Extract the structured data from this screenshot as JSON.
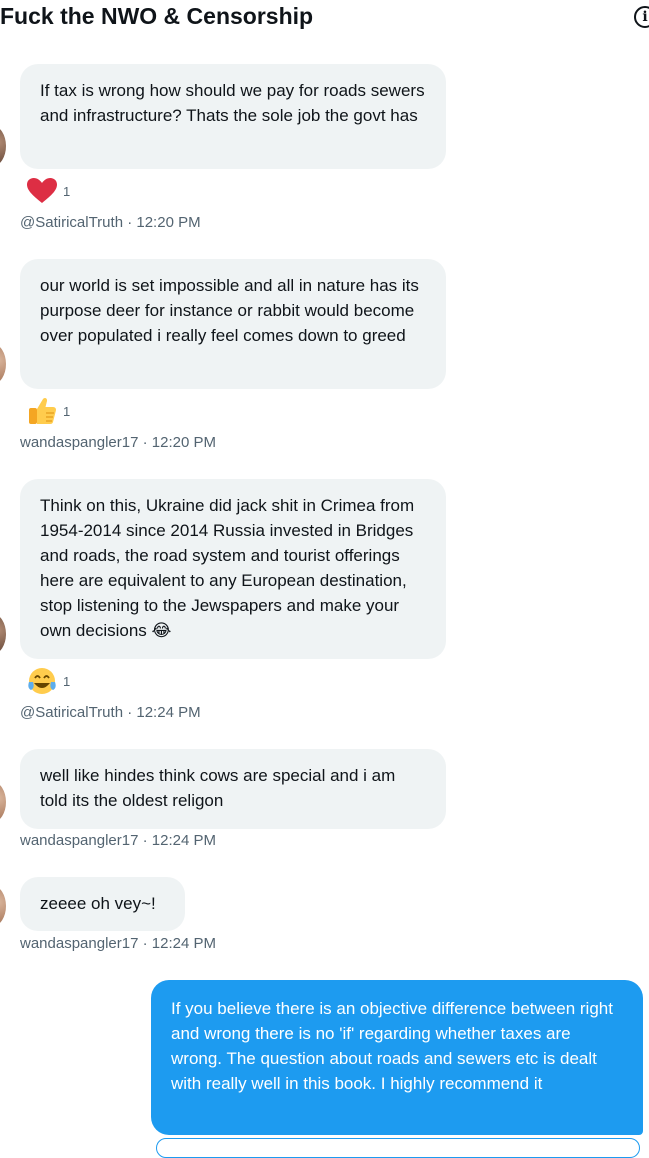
{
  "header": {
    "title": "Fuck the NWO & Censorship",
    "info_icon": "info-icon"
  },
  "messages": [
    {
      "text": "If tax is wrong how should we pay for roads sewers and infrastructure? Thats the sole job the govt has",
      "reaction": {
        "icon": "heart-emoji",
        "count": "1"
      },
      "sender": "@SatiricalTruth",
      "time": "12:20 PM"
    },
    {
      "text": "our world is set impossible and all in nature has its purpose deer for instance or rabbit would become over populated i really feel comes down to greed",
      "reaction": {
        "icon": "thumbs-up-emoji",
        "count": "1"
      },
      "sender": "wandaspangler17",
      "time": "12:20 PM"
    },
    {
      "text": "Think on this, Ukraine did jack shit in Crimea from 1954-2014 since 2014 Russia invested in Bridges and roads, the road system and tourist offerings here are equivalent to any European destination, stop listening to the Jewspapers and make your own decisions 😂",
      "reaction": {
        "icon": "tears-of-joy-emoji",
        "count": "1"
      },
      "sender": "@SatiricalTruth",
      "time": "12:24 PM"
    },
    {
      "text": "well like hindes think cows are special and i am told its the oldest religon",
      "sender": "wandaspangler17",
      "time": "12:24 PM"
    },
    {
      "text": "zeeee oh vey~!",
      "sender": "wandaspangler17",
      "time": "12:24 PM"
    },
    {
      "text": "If you believe there is an objective difference between right and wrong there is no 'if' regarding whether taxes are wrong. The question about roads and sewers etc is dealt with really well in this book. I highly recommend it",
      "mine": true
    }
  ],
  "meta_separator": " · ",
  "colors": {
    "own_bubble": "#1d9bf0",
    "other_bubble": "#eff3f4",
    "meta_text": "#536471"
  }
}
